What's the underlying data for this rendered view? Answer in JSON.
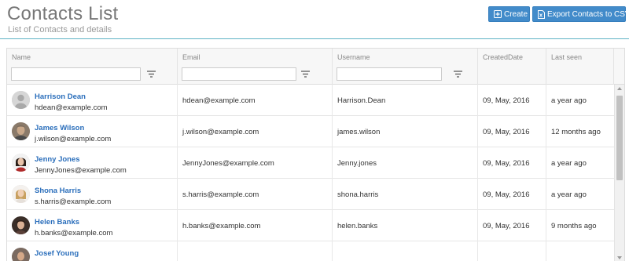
{
  "page": {
    "title": "Contacts List",
    "subtitle": "List of Contacts and details"
  },
  "toolbar": {
    "create_label": "Create",
    "create_icon": "plus-square-icon",
    "export_label": "Export Contacts to CSV",
    "export_icon": "file-excel-icon",
    "button_color": "#428bca"
  },
  "table": {
    "columns": [
      {
        "label": "Name",
        "filter_icon": "filter-lines-icon"
      },
      {
        "label": "Email",
        "filter_icon": "filter-lines-icon"
      },
      {
        "label": "Username",
        "filter_icon": "filter-lines-icon"
      },
      {
        "label": "CreatedDate"
      },
      {
        "label": "Last seen"
      }
    ],
    "filters": {
      "name": "",
      "email": "",
      "username": ""
    },
    "rows": [
      {
        "name": "Harrison Dean",
        "email": "hdean@example.com",
        "username": "Harrison.Dean",
        "created": "09, May, 2016",
        "last_seen": "a year ago",
        "avatar": "default-avatar"
      },
      {
        "name": "James Wilson",
        "email": "j.wilson@example.com",
        "username": "james.wilson",
        "created": "09, May, 2016",
        "last_seen": "12 months ago",
        "avatar": "photo-avatar"
      },
      {
        "name": "Jenny Jones",
        "email": "JennyJones@example.com",
        "username": "Jenny.jones",
        "created": "09, May, 2016",
        "last_seen": "a year ago",
        "avatar": "photo-avatar"
      },
      {
        "name": "Shona Harris",
        "email": "s.harris@example.com",
        "username": "shona.harris",
        "created": "09, May, 2016",
        "last_seen": "a year ago",
        "avatar": "photo-avatar"
      },
      {
        "name": "Helen Banks",
        "email": "h.banks@example.com",
        "username": "helen.banks",
        "created": "09, May, 2016",
        "last_seen": "9 months ago",
        "avatar": "photo-avatar"
      },
      {
        "name": "Josef Young",
        "email": "",
        "username": "",
        "created": "",
        "last_seen": "",
        "avatar": "photo-avatar"
      }
    ],
    "link_color": "#2a6ebb"
  }
}
